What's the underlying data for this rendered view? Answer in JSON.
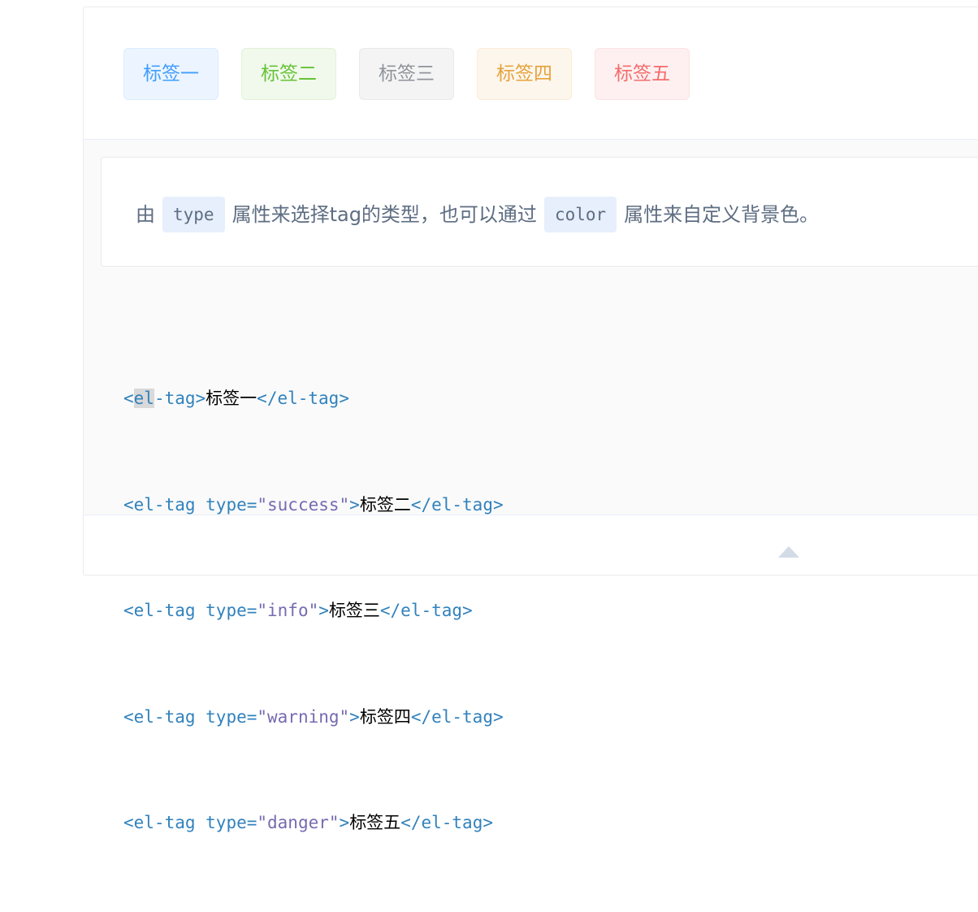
{
  "tags": [
    {
      "label": "标签一",
      "type": "default"
    },
    {
      "label": "标签二",
      "type": "success"
    },
    {
      "label": "标签三",
      "type": "info"
    },
    {
      "label": "标签四",
      "type": "warning"
    },
    {
      "label": "标签五",
      "type": "danger"
    }
  ],
  "description": {
    "prefix": "由",
    "code1": "type",
    "middle": "属性来选择tag的类型，也可以通过",
    "code2": "color",
    "suffix": "属性来自定义背景色。"
  },
  "code": {
    "lines": [
      {
        "open": "<el-tag>",
        "text": "标签一",
        "close": "</el-tag>"
      },
      {
        "tag": "<el-tag ",
        "attr": "type=",
        "value": "\"success\"",
        "gt": ">",
        "text": "标签二",
        "close": "</el-tag>"
      },
      {
        "tag": "<el-tag ",
        "attr": "type=",
        "value": "\"info\"",
        "gt": ">",
        "text": "标签三",
        "close": "</el-tag>"
      },
      {
        "tag": "<el-tag ",
        "attr": "type=",
        "value": "\"warning\"",
        "gt": ">",
        "text": "标签四",
        "close": "</el-tag>"
      },
      {
        "tag": "<el-tag ",
        "attr": "type=",
        "value": "\"danger\"",
        "gt": ">",
        "text": "标签五",
        "close": "</el-tag>"
      }
    ]
  },
  "colors": {
    "primary": "#409eff",
    "success": "#67c23a",
    "info": "#909399",
    "warning": "#e6a23c",
    "danger": "#f56c6c",
    "code_tag": "#3182bd",
    "code_string": "#756bb1"
  },
  "icons": {
    "toggle": "caret-up-icon"
  }
}
